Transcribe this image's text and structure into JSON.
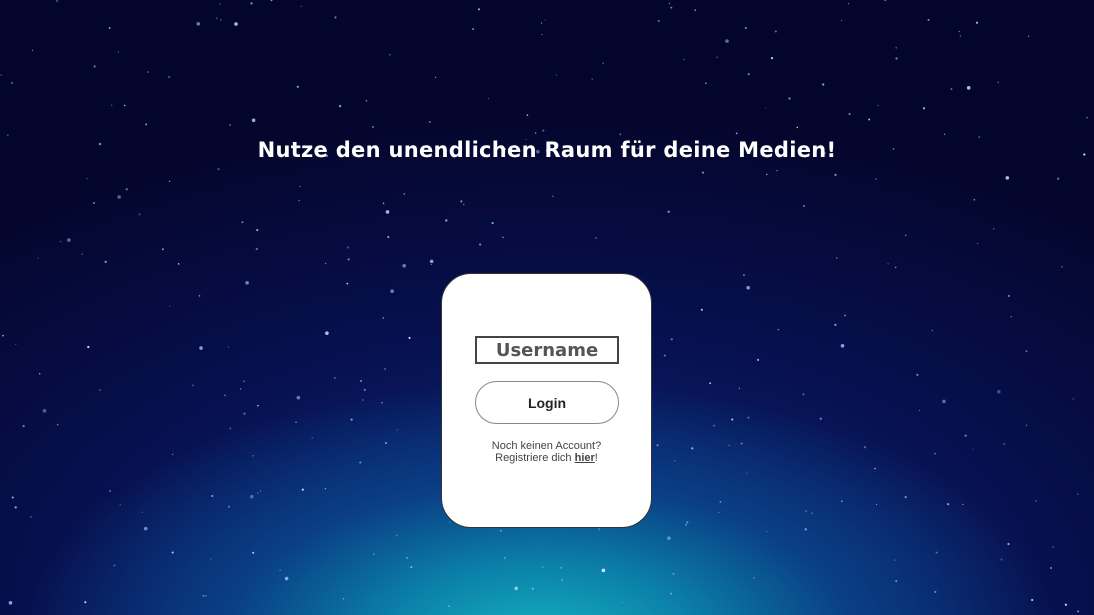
{
  "headline": "Nutze den unendlichen Raum für deine Medien!",
  "login_form": {
    "username_placeholder": "Username",
    "username_value": "",
    "login_label": "Login",
    "no_account_text": "Noch keinen Account?",
    "register_prefix": "Registriere dich ",
    "register_link": "hier",
    "register_suffix": "!"
  },
  "colors": {
    "background_top": "#04052a",
    "background_glow": "#14b0c0",
    "card": "#ffffff"
  }
}
